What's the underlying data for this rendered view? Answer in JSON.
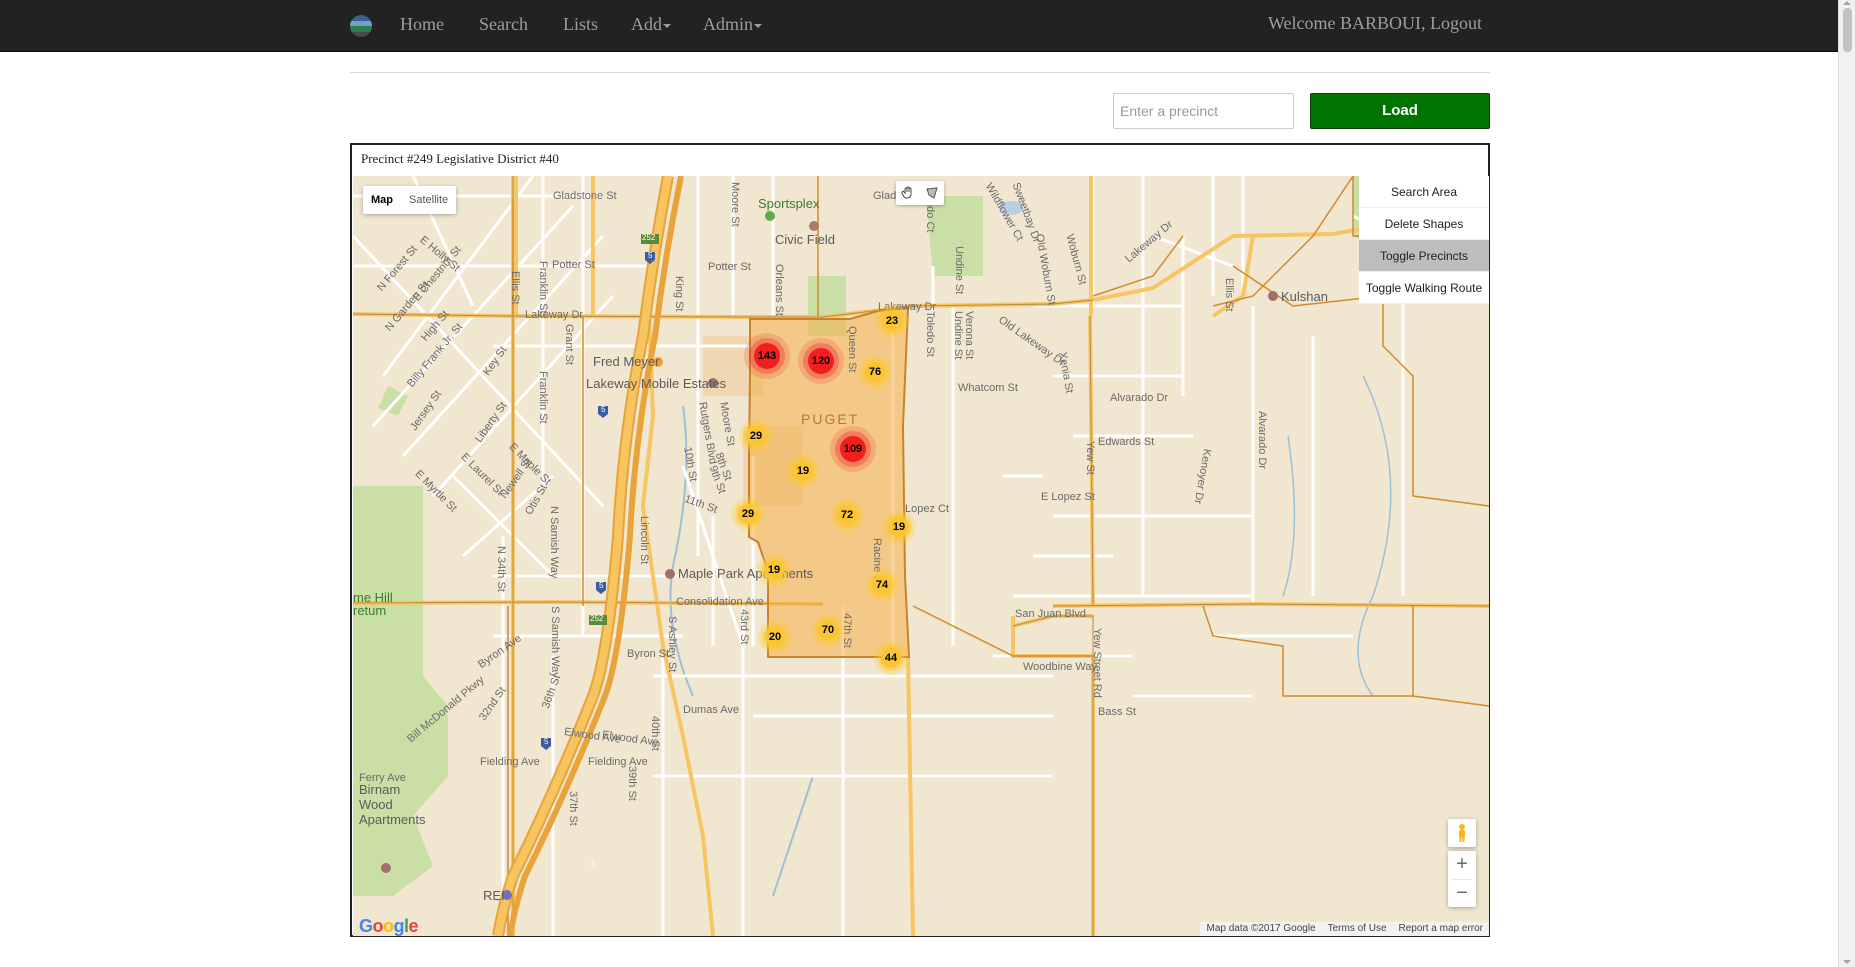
{
  "navbar": {
    "brand_icon": "logo-icon",
    "items": [
      "Home",
      "Search",
      "Lists",
      "Add",
      "Admin"
    ],
    "welcome": "Welcome BARBOUI,",
    "logout": "Logout"
  },
  "form": {
    "placeholder": "Enter a precinct",
    "load_label": "Load",
    "load_color": "#007400"
  },
  "panel": {
    "title": "Precinct #249 Legislative District #40"
  },
  "map": {
    "type_controls": [
      "Map",
      "Satellite"
    ],
    "selected_type": "Map",
    "draw_tools": [
      "hand-icon",
      "polygon-icon"
    ],
    "side_buttons": [
      "Search Area",
      "Delete Shapes",
      "Toggle Precincts",
      "Toggle Walking Route"
    ],
    "pressed_button": "Toggle Precincts",
    "precinct_label": "PUGET",
    "precinct_fill": "#f5b04d",
    "clusters": [
      {
        "count": "143",
        "level": "high"
      },
      {
        "count": "120",
        "level": "high"
      },
      {
        "count": "109",
        "level": "high"
      },
      {
        "count": "23",
        "level": "low"
      },
      {
        "count": "76",
        "level": "low"
      },
      {
        "count": "29",
        "level": "low"
      },
      {
        "count": "19",
        "level": "low"
      },
      {
        "count": "29",
        "level": "low"
      },
      {
        "count": "72",
        "level": "low"
      },
      {
        "count": "19",
        "level": "low"
      },
      {
        "count": "19",
        "level": "low"
      },
      {
        "count": "74",
        "level": "low"
      },
      {
        "count": "20",
        "level": "low"
      },
      {
        "count": "70",
        "level": "low"
      },
      {
        "count": "44",
        "level": "low"
      }
    ],
    "streets": [
      "Gladstone St",
      "Gladstone St",
      "E Holly St",
      "N Forest St",
      "E Chestnut St",
      "N Garden St",
      "High St",
      "Billy Frank Jr. St",
      "Ellis St",
      "Franklin St",
      "Potter St",
      "Potter St",
      "Lakeway Dr",
      "Grant St",
      "King St",
      "Orleans St",
      "Moore St",
      "Key St",
      "Jersey St",
      "Liberty St",
      "E Maple St",
      "E Laurel St",
      "E Myrtle St",
      "Newell St",
      "Otis St",
      "Franklin St",
      "N Samish Way",
      "N 34th St",
      "Lincoln St",
      "Rutgers Blvd",
      "Moore St",
      "8th St",
      "9th St",
      "10th St",
      "11th St",
      "Consolidation Ave",
      "S Samish Way",
      "S Ashley St",
      "43rd St",
      "47th St",
      "Byron St",
      "Byron Ave",
      "Bill McDonald Pkwy",
      "32nd St",
      "36th St",
      "Elwood Ave",
      "Elwood Ave",
      "Fielding Ave",
      "Fielding Ave",
      "Dumas Ave",
      "40th St",
      "39th St",
      "37th St",
      "Ferry Ave",
      "Queen St",
      "Lakeway Dr",
      "Toledo Ct",
      "Toledo St",
      "Undine St",
      "Verona St",
      "Undine St",
      "Old Lakeway Dr",
      "Whatcom St",
      "Wildflower Ct",
      "Sweetbay Dr",
      "Old Woburn St",
      "Woburn St",
      "Lakeway Dr",
      "Xenia St",
      "Alvarado Dr",
      "Alvarado Dr",
      "Edwards St",
      "Yew St",
      "E Lopez St",
      "Lopez Ct",
      "Racine St",
      "San Juan Blvd",
      "Woodbine Way",
      "Yew Street Rd",
      "Bass St",
      "Kenoyer Dr",
      "Ellis St"
    ],
    "pois": [
      "Sportsplex",
      "Civic Field",
      "Fred Meyer",
      "Lakeway Mobile Estates",
      "Maple Park Apartments",
      "Birnam Wood Apartments",
      "REI",
      "Kulshan"
    ],
    "green_labels": [
      "me Hill",
      "retum"
    ],
    "highway_labels": [
      "5",
      "5",
      "5",
      "5",
      "5"
    ],
    "highway_shields": [
      "252",
      "252"
    ],
    "google_logo": "Google",
    "attribution": [
      "Map data ©2017 Google",
      "Terms of Use",
      "Report a map error"
    ],
    "zoom_in": "+",
    "zoom_out": "−"
  }
}
